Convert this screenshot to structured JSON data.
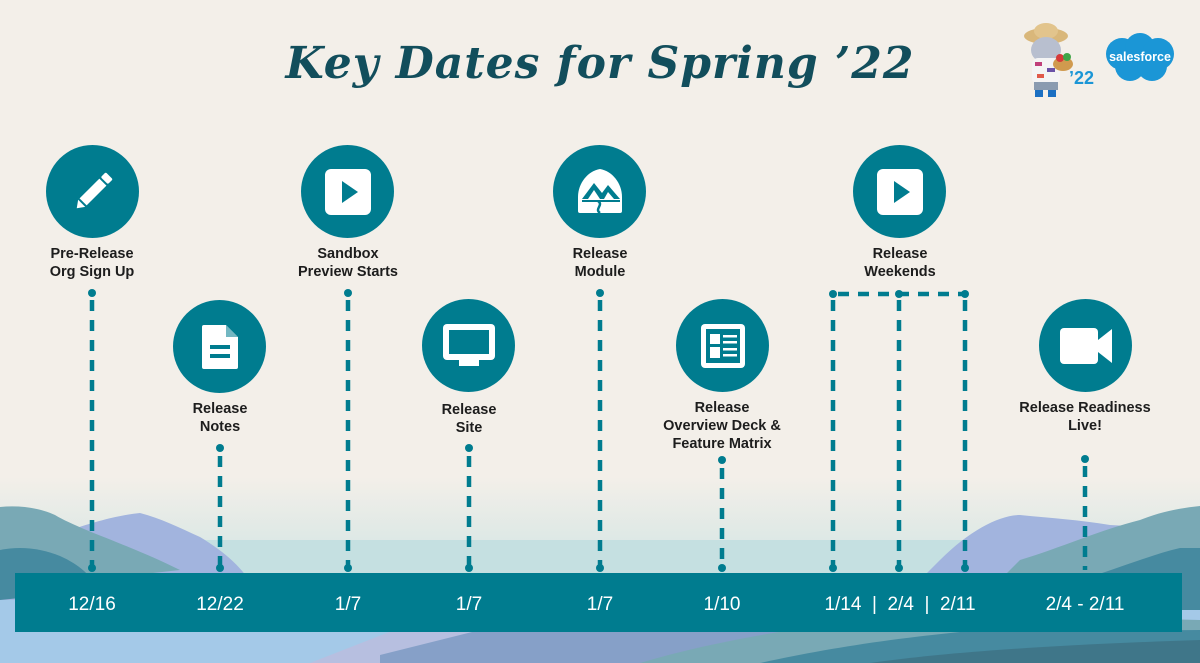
{
  "title": "Key Dates for Spring ’22",
  "branding": {
    "mascot_year": "’22",
    "logo_text": "salesforce",
    "mascot_icon": "astro-elephant-mascot",
    "logo_icon": "salesforce-cloud-logo"
  },
  "colors": {
    "teal": "#007c8f",
    "title": "#124e5c",
    "background": "#f3efe9",
    "logo_blue": "#1b96d6"
  },
  "milestones": [
    {
      "label_line1": "Pre-Release",
      "label_line2": "Org Sign Up",
      "label_line3": "",
      "icon": "pencil-icon",
      "date": "12/16"
    },
    {
      "label_line1": "Release",
      "label_line2": "Notes",
      "label_line3": "",
      "icon": "document-icon",
      "date": "12/22"
    },
    {
      "label_line1": "Sandbox",
      "label_line2": "Preview Starts",
      "label_line3": "",
      "icon": "play-icon",
      "date": "1/7"
    },
    {
      "label_line1": "Release",
      "label_line2": "Site",
      "label_line3": "",
      "icon": "monitor-icon",
      "date": "1/7"
    },
    {
      "label_line1": "Release",
      "label_line2": "Module",
      "label_line3": "",
      "icon": "trailhead-mountain-icon",
      "date": "1/7"
    },
    {
      "label_line1": "Release",
      "label_line2": "Overview Deck &",
      "label_line3": "Feature Matrix",
      "icon": "news-layout-icon",
      "date": "1/10"
    },
    {
      "label_line1": "Release",
      "label_line2": "Weekends",
      "label_line3": "",
      "icon": "play-icon",
      "date": "1/14  |  2/4  |  2/11"
    },
    {
      "label_line1": "Release Readiness",
      "label_line2": "Live!",
      "label_line3": "",
      "icon": "video-camera-icon",
      "date": "2/4 - 2/11"
    }
  ]
}
